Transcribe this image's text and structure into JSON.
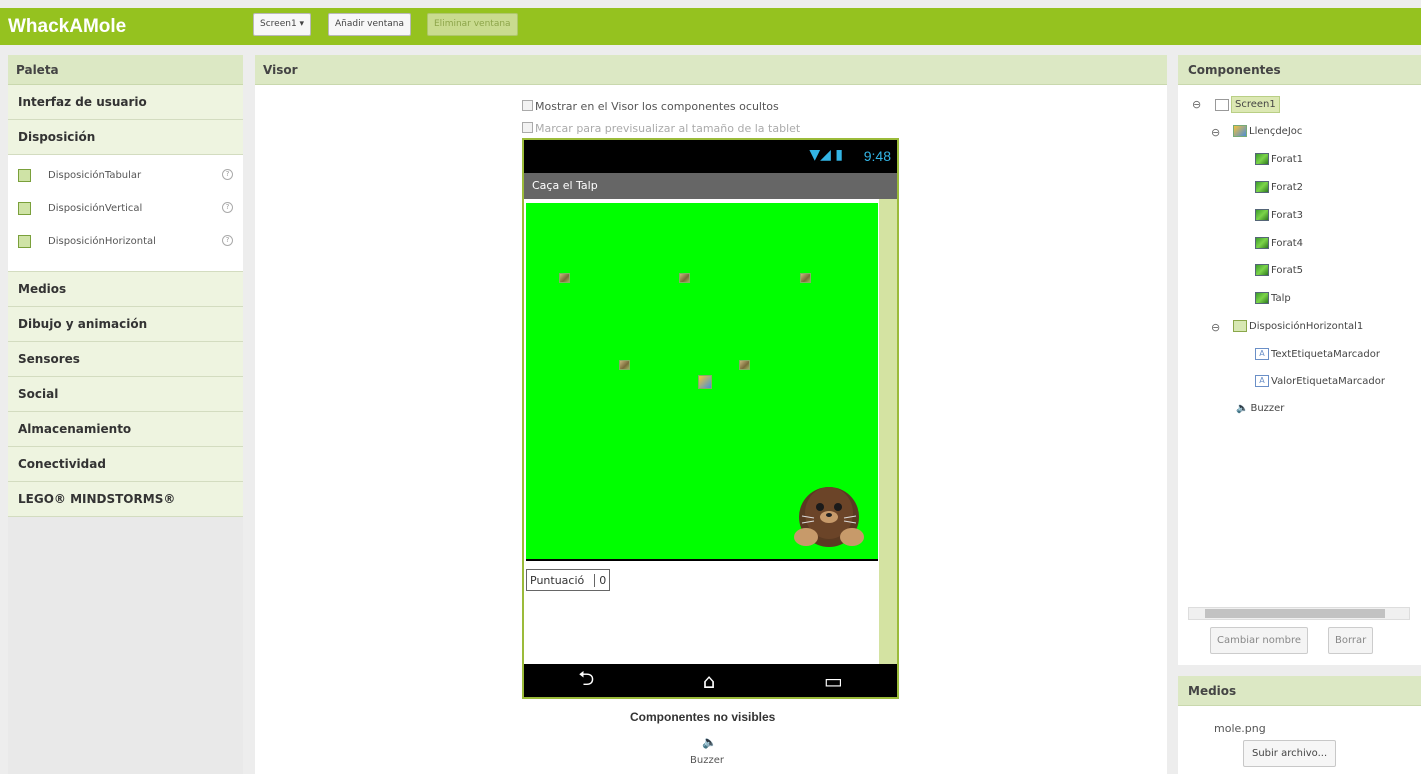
{
  "app": {
    "title": "WhackAMole",
    "screen_dropdown": "Screen1 ▾",
    "add_screen": "Añadir ventana",
    "remove_screen": "Eliminar ventana"
  },
  "palette": {
    "header": "Paleta",
    "categories": [
      "Interfaz de usuario",
      "Disposición",
      "Medios",
      "Dibujo y animación",
      "Sensores",
      "Social",
      "Almacenamiento",
      "Conectividad",
      "LEGO® MINDSTORMS®"
    ],
    "items": [
      {
        "label": "DisposiciónTabular",
        "icon": "table-layout-icon"
      },
      {
        "label": "DisposiciónVertical",
        "icon": "vertical-layout-icon"
      },
      {
        "label": "DisposiciónHorizontal",
        "icon": "horizontal-layout-icon"
      }
    ],
    "help_glyph": "?"
  },
  "visor": {
    "header": "Visor",
    "show_hidden": "Mostrar en el Visor los componentes ocultos",
    "tablet_preview": "Marcar para previsualizar al tamaño de la tablet",
    "phone": {
      "time": "9:48",
      "status_icons": "▼◢ ▮",
      "app_title": "Caça el Talp",
      "score_label": "Puntuació",
      "score_value": "0",
      "nav_back": "⮌",
      "nav_home": "⌂",
      "nav_recent": "▭"
    },
    "nonvisible_title": "Componentes no visibles",
    "buzzer_label": "Buzzer",
    "colors": {
      "canvas": "#00ff00",
      "accent": "#95c21f"
    }
  },
  "components": {
    "header": "Componentes",
    "tree": [
      {
        "label": "Screen1",
        "icon": "screen-icon"
      },
      {
        "label": "LlençdeJoc",
        "icon": "canvas-icon"
      },
      {
        "label": "Forat1",
        "icon": "image-sprite-icon"
      },
      {
        "label": "Forat2",
        "icon": "image-sprite-icon"
      },
      {
        "label": "Forat3",
        "icon": "image-sprite-icon"
      },
      {
        "label": "Forat4",
        "icon": "image-sprite-icon"
      },
      {
        "label": "Forat5",
        "icon": "image-sprite-icon"
      },
      {
        "label": "Talp",
        "icon": "image-sprite-icon"
      },
      {
        "label": "DisposiciónHorizontal1",
        "icon": "horizontal-layout-icon"
      },
      {
        "label": "TextEtiquetaMarcador",
        "icon": "label-icon"
      },
      {
        "label": "ValorEtiquetaMarcador",
        "icon": "label-icon"
      },
      {
        "label": "Buzzer",
        "icon": "sound-icon"
      }
    ],
    "collapse_glyph": "⊖",
    "rename": "Cambiar nombre",
    "delete": "Borrar"
  },
  "media": {
    "header": "Medios",
    "file": "mole.png",
    "upload": "Subir archivo..."
  }
}
